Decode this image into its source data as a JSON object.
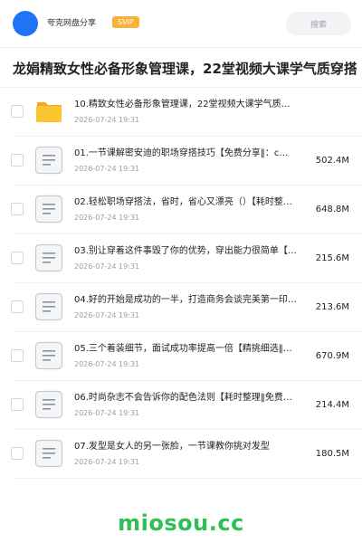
{
  "header": {
    "user_name": "夸克网盘分享",
    "vip_label": "SVIP",
    "search_placeholder": "搜索"
  },
  "page_title": "龙娟精致女性必备形象管理课，22堂视频大课学气质穿搭",
  "colors": {
    "avatar": "#1e74f5",
    "vip_badge": "#f7b23a",
    "folder": "#fbc531",
    "watermark": "#2fbf55"
  },
  "files": [
    {
      "type": "folder",
      "icon": "folder-icon",
      "name": "10.精致女性必备形象管理课，22堂视频大课学气质…",
      "date": "2026-07-24 19:31",
      "size": ""
    },
    {
      "type": "file",
      "icon": "document-icon",
      "name": "01.一节课解密安迪的职场穿搭技巧【免费分享‖：c…",
      "date": "2026-07-24 19:31",
      "size": "502.4M"
    },
    {
      "type": "file",
      "icon": "document-icon",
      "name": "02.轻松职场穿搭法，省时，省心又漂亮（）【耗时整…",
      "date": "2026-07-24 19:31",
      "size": "648.8M"
    },
    {
      "type": "file",
      "icon": "document-icon",
      "name": "03.别让穿着这件事毁了你的优势，穿出能力很简单【…",
      "date": "2026-07-24 19:31",
      "size": "215.6M"
    },
    {
      "type": "file",
      "icon": "document-icon",
      "name": "04.好的开始是成功的一半，打造商务会谈完美第一印…",
      "date": "2026-07-24 19:31",
      "size": "213.6M"
    },
    {
      "type": "file",
      "icon": "document-icon",
      "name": "05.三个着装细节，面试成功率提高一倍【精挑细选‖…",
      "date": "2026-07-24 19:31",
      "size": "670.9M"
    },
    {
      "type": "file",
      "icon": "document-icon",
      "name": "06.时尚杂志不会告诉你的配色法则【耗时整理‖免费…",
      "date": "2026-07-24 19:31",
      "size": "214.4M"
    },
    {
      "type": "file",
      "icon": "document-icon",
      "name": "07.发型是女人的另一张脸，一节课教你挑对发型",
      "date": "2026-07-24 19:31",
      "size": "180.5M"
    }
  ],
  "watermark": "miosou.cc"
}
